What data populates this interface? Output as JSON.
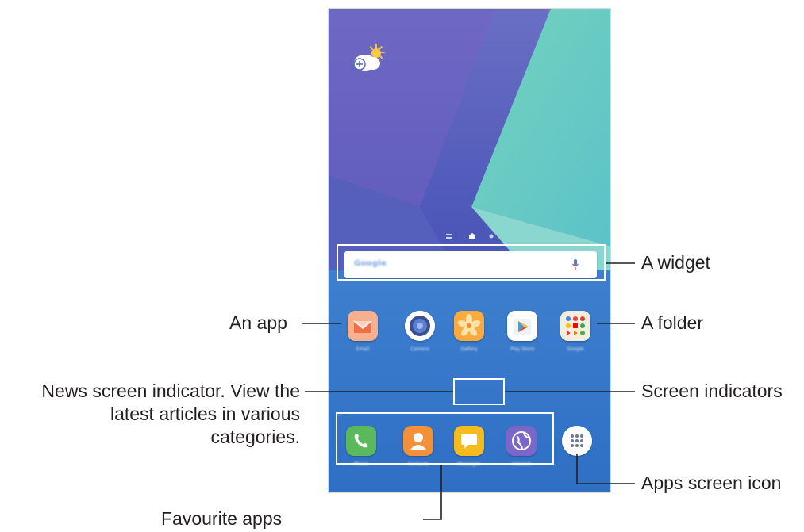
{
  "home_screen": {
    "search_widget": {
      "brand": "Google"
    },
    "apps": [
      {
        "label": "Email",
        "icon": "email-icon",
        "color": "#f7a98f"
      },
      {
        "label": "Camera",
        "icon": "camera-icon",
        "color": "#ffffff"
      },
      {
        "label": "Gallery",
        "icon": "gallery-icon",
        "color": "#f7a23a"
      },
      {
        "label": "Play Store",
        "icon": "play-store-icon",
        "color": "#ffffff"
      },
      {
        "label": "Google",
        "icon": "folder-icon",
        "color": "#f5efe0"
      }
    ],
    "favourites": [
      {
        "label": "Phone",
        "icon": "phone-icon",
        "color": "#5cb85c"
      },
      {
        "label": "Contacts",
        "icon": "contacts-icon",
        "color": "#f3903a"
      },
      {
        "label": "Messages",
        "icon": "messages-icon",
        "color": "#f8bb1e"
      },
      {
        "label": "Internet",
        "icon": "internet-icon",
        "color": "#7b67c9"
      }
    ],
    "apps_button": {
      "icon": "apps-grid-icon"
    }
  },
  "callouts": {
    "widget": "A widget",
    "folder": "A folder",
    "app": "An app",
    "screen_indicators": "Screen indicators",
    "news_line1": "News screen indicator. View the",
    "news_line2": "latest articles in various",
    "news_line3": "categories.",
    "apps_screen_icon": "Apps screen icon",
    "favourite_apps": "Favourite apps"
  }
}
